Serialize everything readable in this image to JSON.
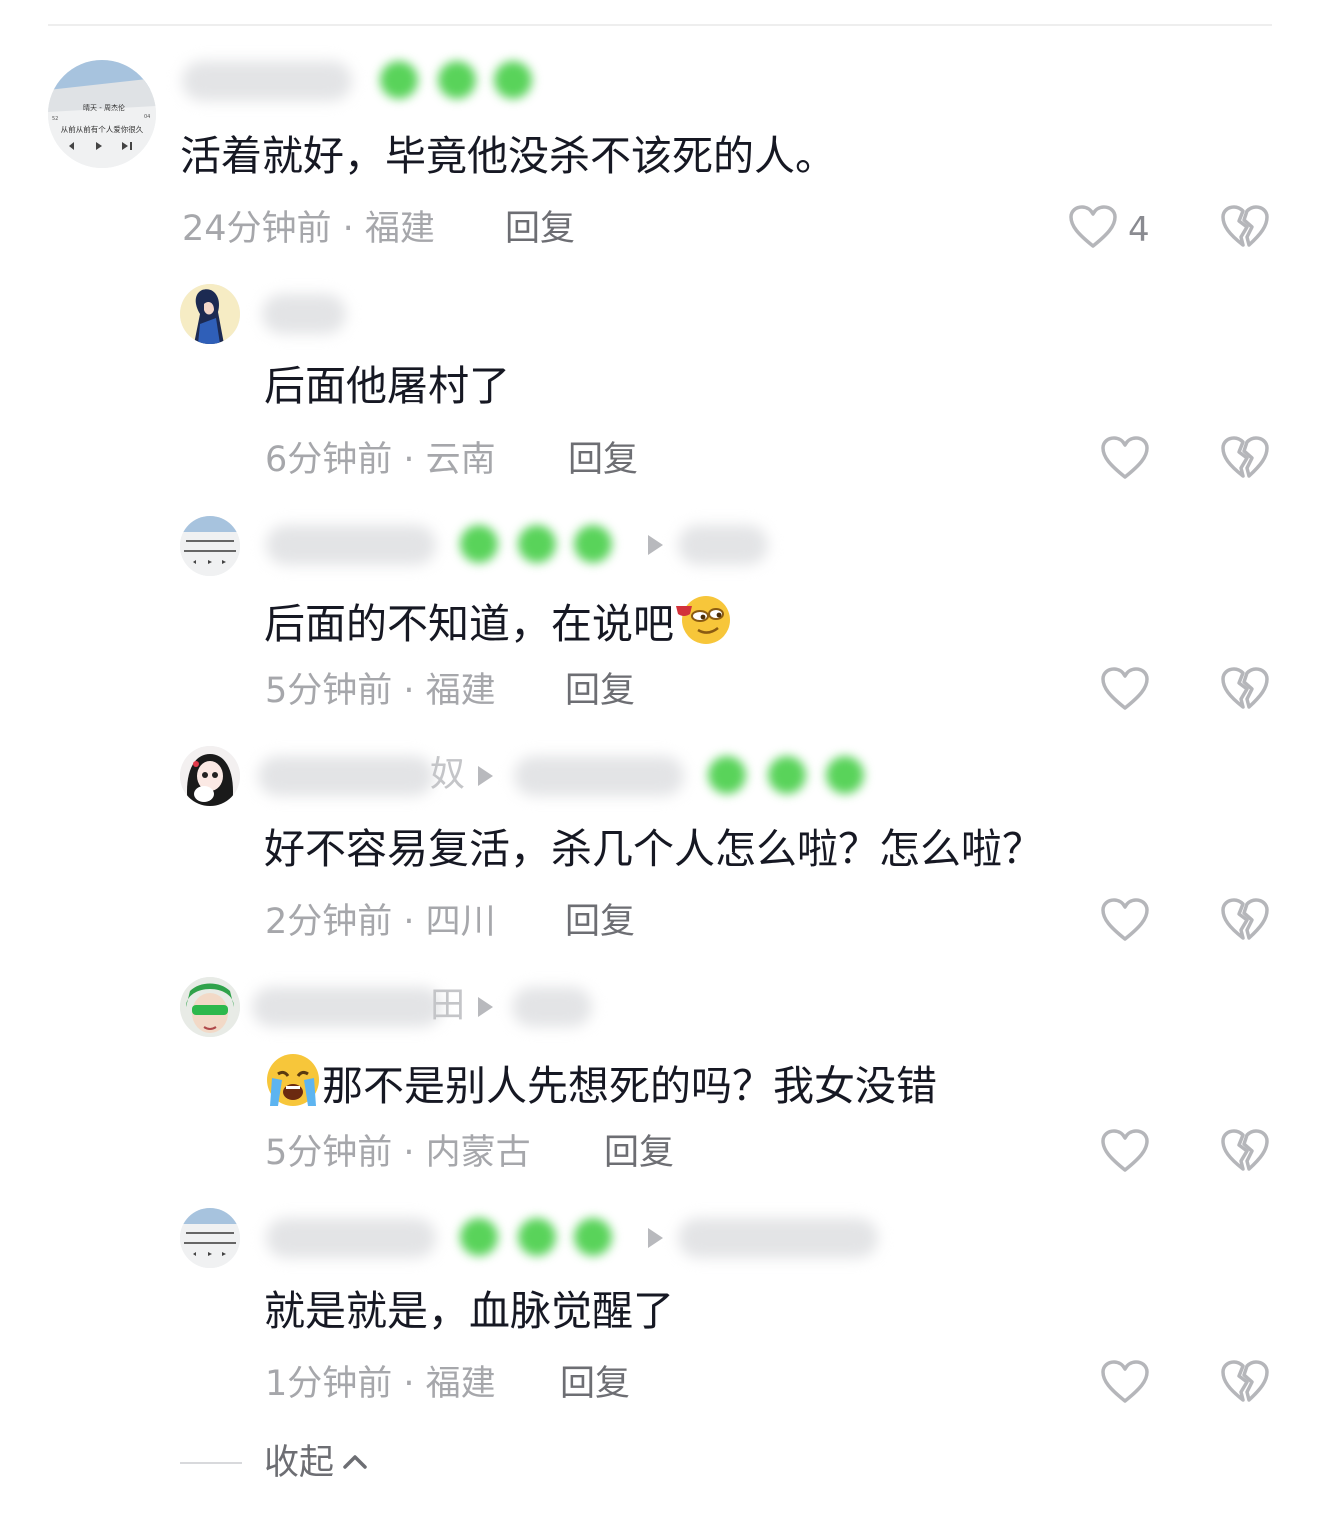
{
  "comments": [
    {
      "text": "活着就好，毕竟他没杀不该死的人。",
      "time": "24分钟前 · 福建",
      "reply": "回复",
      "likes": "4"
    },
    {
      "text": "后面他屠村了",
      "time": "6分钟前 · 云南",
      "reply": "回复"
    },
    {
      "text": "后面的不知道，在说吧",
      "time": "5分钟前 · 福建",
      "reply": "回复"
    },
    {
      "name_suffix": "奴",
      "text": "好不容易复活，杀几个人怎么啦？怎么啦？",
      "time": "2分钟前 · 四川",
      "reply": "回复"
    },
    {
      "name_suffix": "田",
      "text": "那不是别人先想死的吗？我女没错",
      "time": "5分钟前 · 内蒙古",
      "reply": "回复"
    },
    {
      "text": "就是就是，血脉觉醒了",
      "time": "1分钟前 · 福建",
      "reply": "回复"
    }
  ],
  "avatar_text": {
    "line1": "晴天 - 周杰伦",
    "line2": "从前从前有个人爱你很久"
  },
  "collapse_label": "收起",
  "icons": {
    "like": "heart-outline-icon",
    "dislike": "broken-heart-icon",
    "collapse": "chevron-up-icon"
  },
  "colors": {
    "text": "#161823",
    "meta": "#a6a7ab",
    "reply": "#6d6e73",
    "icon": "#b5b6ba"
  }
}
